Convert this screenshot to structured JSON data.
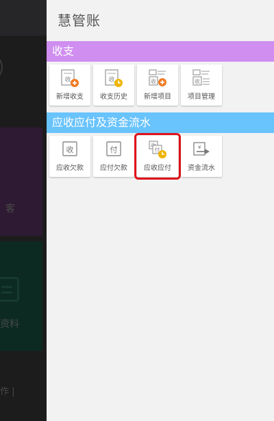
{
  "background_app": {
    "partial_label_customers": "客",
    "partial_label_materials": "资料",
    "partial_bottom_text": "作 |"
  },
  "drawer": {
    "title": "慧管账",
    "sections": [
      {
        "title": "收支",
        "color": "#cf8ef0",
        "items": [
          {
            "label": "新增收支",
            "icon": "income-add-icon"
          },
          {
            "label": "收支历史",
            "icon": "income-history-icon"
          },
          {
            "label": "新增项目",
            "icon": "project-add-icon"
          },
          {
            "label": "项目管理",
            "icon": "project-manage-icon"
          }
        ]
      },
      {
        "title": "应收应付及资金流水",
        "color": "#69c3fc",
        "items": [
          {
            "label": "应收欠款",
            "icon": "receivable-debt-icon"
          },
          {
            "label": "应付欠款",
            "icon": "payable-debt-icon"
          },
          {
            "label": "应收应付",
            "icon": "receivable-payable-icon",
            "selected": true
          },
          {
            "label": "资金流水",
            "icon": "cash-flow-icon"
          }
        ]
      }
    ],
    "glyphs": {
      "shou": "收",
      "fu": "付"
    }
  },
  "colors": {
    "add_badge": "#ef7b23",
    "history_badge": "#f0b400",
    "selected_outline": "#e0121a"
  }
}
